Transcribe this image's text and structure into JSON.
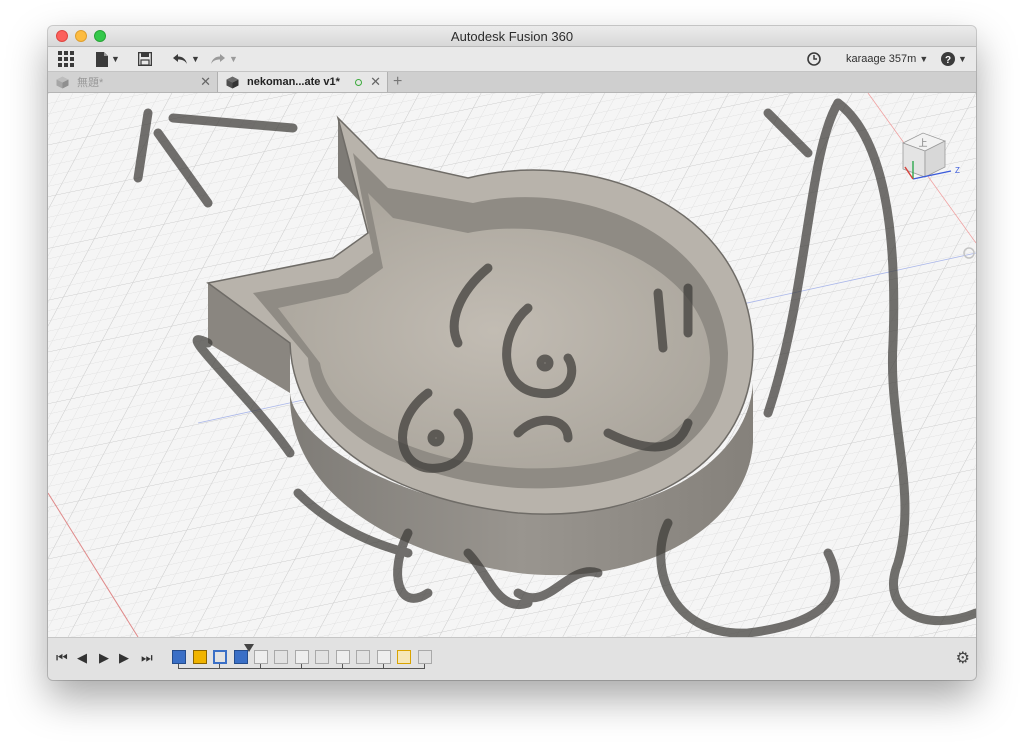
{
  "window": {
    "title": "Autodesk Fusion 360"
  },
  "toolbar": {
    "user_label": "karaage 357m",
    "items": [
      "apps-grid-icon",
      "file-icon",
      "save-icon",
      "undo-icon",
      "redo-icon",
      "history-clock-icon",
      "help-icon"
    ]
  },
  "tabs": [
    {
      "label": "無題*",
      "active": false
    },
    {
      "label": "nekoman...ate v1*",
      "active": true
    }
  ],
  "timeline": {
    "feature_count": 13,
    "colors": {
      "accent": "#f0b400",
      "feature_blue": "#3a6fc6",
      "feature_gray": "#a9a9a9"
    }
  },
  "viewport": {
    "model_color": "#8e8a83",
    "grid_color": "#d9d9d9",
    "viewcube_label": "上"
  }
}
